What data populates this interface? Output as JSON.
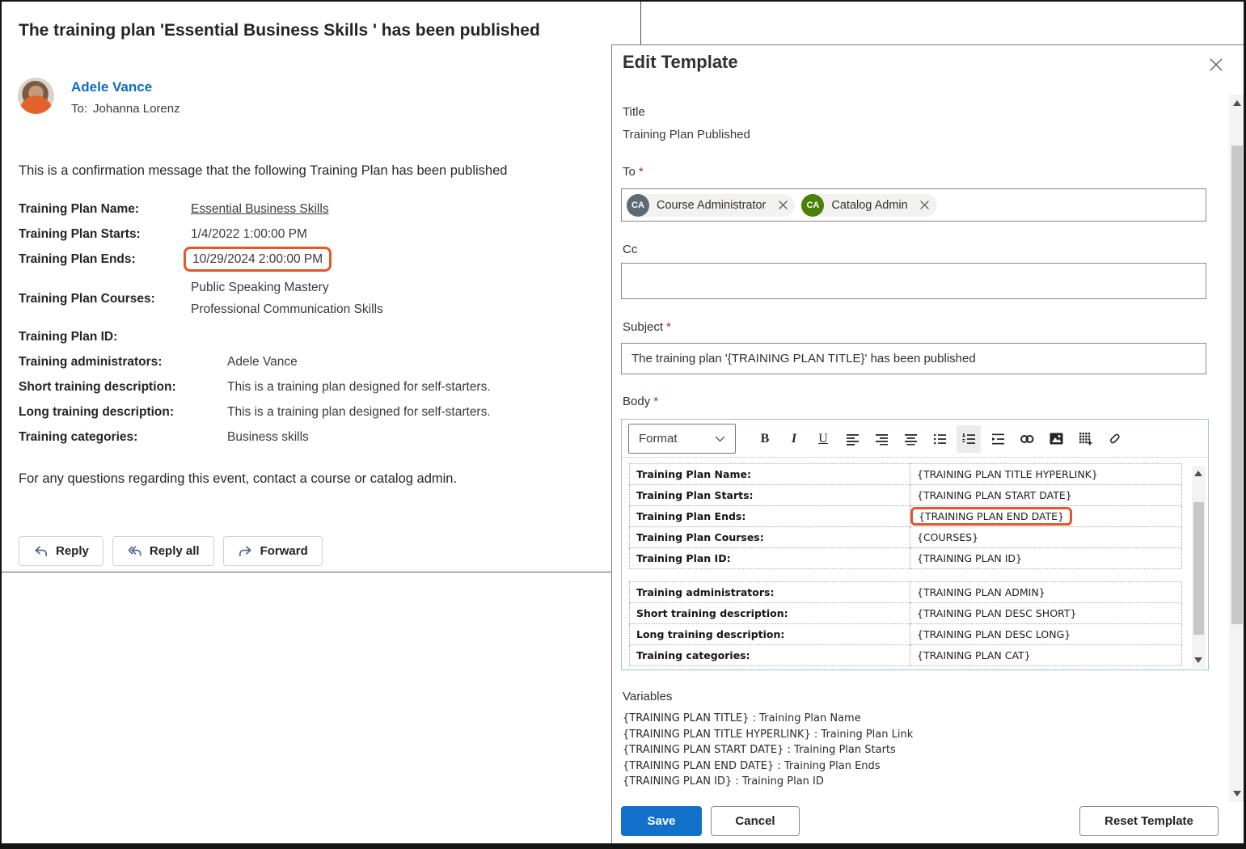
{
  "email": {
    "title": "The training plan 'Essential Business Skills ' has been published",
    "sender_name": "Adele Vance",
    "to_prefix": "To:",
    "recipient": "Johanna Lorenz",
    "intro": "This is a confirmation message that the following Training Plan has been published",
    "fields": [
      {
        "label": "Training Plan Name:",
        "value": "Essential Business Skills"
      },
      {
        "label": "Training Plan Starts:",
        "value": "1/4/2022 1:00:00 PM"
      },
      {
        "label": "Training Plan Ends:",
        "value": "10/29/2024 2:00:00 PM"
      },
      {
        "label": "Training Plan Courses:",
        "value": "Public Speaking Mastery",
        "value2": "Professional Communication Skills"
      },
      {
        "label": "Training Plan ID:",
        "value": ""
      },
      {
        "label": "Training administrators:",
        "value": "Adele Vance"
      },
      {
        "label": "Short training description:",
        "value": "This is a training plan designed for self-starters."
      },
      {
        "label": "Long training description:",
        "value": "This is a training plan designed for self-starters."
      },
      {
        "label": "Training categories:",
        "value": "Business skills"
      }
    ],
    "footer": "For any questions regarding this event, contact a course or catalog admin.",
    "actions": {
      "reply": "Reply",
      "reply_all": "Reply all",
      "forward": "Forward"
    }
  },
  "panel": {
    "header": "Edit Template",
    "required_marker": "*",
    "title_label": "Title",
    "title_value": "Training Plan Published",
    "to_label": "To",
    "to_chips": [
      {
        "initials": "CA",
        "name": "Course Administrator",
        "color": "#5d6b76"
      },
      {
        "initials": "CA",
        "name": "Catalog Admin",
        "color": "#498205"
      }
    ],
    "cc_label": "Cc",
    "cc_value": "",
    "subject_label": "Subject",
    "subject_value": "The training plan '{TRAINING PLAN TITLE}' has been published",
    "body_label": "Body",
    "toolbar": {
      "format_label": "Format",
      "bold": "B",
      "italic": "I",
      "underline": "U"
    },
    "body_table_1": [
      {
        "label": "Training Plan Name:",
        "value": "{TRAINING PLAN TITLE HYPERLINK}"
      },
      {
        "label": "Training Plan Starts:",
        "value": "{TRAINING PLAN START DATE}"
      },
      {
        "label": "Training Plan Ends:",
        "value": "{TRAINING PLAN END DATE}"
      },
      {
        "label": "Training Plan Courses:",
        "value": "{COURSES}"
      },
      {
        "label": "Training Plan ID:",
        "value": "{TRAINING PLAN ID}"
      }
    ],
    "body_table_2": [
      {
        "label": "Training administrators:",
        "value": "{TRAINING PLAN ADMIN}"
      },
      {
        "label": "Short training description:",
        "value": "{TRAINING PLAN DESC SHORT}"
      },
      {
        "label": "Long training description:",
        "value": "{TRAINING PLAN DESC LONG}"
      },
      {
        "label": "Training categories:",
        "value": "{TRAINING PLAN CAT}"
      }
    ],
    "variables_label": "Variables",
    "variables": [
      "{TRAINING PLAN TITLE} : Training Plan Name",
      "{TRAINING PLAN TITLE HYPERLINK} : Training Plan Link",
      "{TRAINING PLAN START DATE} : Training Plan Starts",
      "{TRAINING PLAN END DATE} : Training Plan Ends",
      "{TRAINING PLAN ID} : Training Plan ID"
    ],
    "buttons": {
      "save": "Save",
      "cancel": "Cancel",
      "reset": "Reset Template"
    },
    "colors": {
      "accent": "#0f6cbd",
      "highlight": "#e2572b",
      "chip_gray": "#5d6b76",
      "chip_green": "#498205"
    }
  }
}
